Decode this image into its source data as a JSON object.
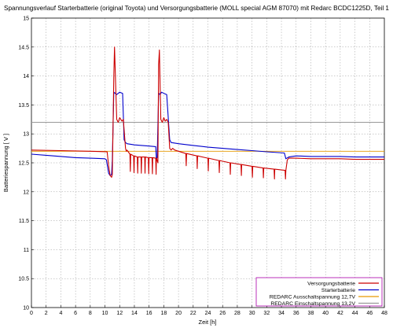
{
  "chart_data": {
    "type": "line",
    "title": "Spannungsverlauf Starterbatterie (original Toyota) und Versorgungsbatterie (MOLL special AGM 87070) mit Redarc BCDC1225D, Teil 1",
    "xlabel": "Zeit [h]",
    "ylabel": "Batteriespannung [ V ]",
    "xlim": [
      0,
      48
    ],
    "ylim": [
      10,
      15
    ],
    "x_ticks": [
      "0",
      "2",
      "4",
      "6",
      "8",
      "10",
      "12",
      "14",
      "16",
      "18",
      "20",
      "22",
      "24",
      "26",
      "28",
      "30",
      "32",
      "34",
      "36",
      "38",
      "40",
      "42",
      "44",
      "46",
      "48"
    ],
    "y_ticks": [
      "10",
      "10.5",
      "11",
      "11.5",
      "12",
      "12.5",
      "13",
      "13.5",
      "14",
      "14.5",
      "15"
    ],
    "grid": true,
    "legend_position": "bottom-right",
    "series": [
      {
        "name": "Versorgungsbatterie",
        "color": "#cc0000",
        "x": [
          0,
          4,
          8,
          10.3,
          10.5,
          10.7,
          10.9,
          11.0,
          11.2,
          11.3,
          11.6,
          11.8,
          12.0,
          12.3,
          12.5,
          12.8,
          12.9,
          13.0,
          13.4,
          13.45,
          13.5,
          13.9,
          13.95,
          14.0,
          14.4,
          14.45,
          14.5,
          14.9,
          14.95,
          15.0,
          15.4,
          15.45,
          15.5,
          15.9,
          15.95,
          16.0,
          16.4,
          16.45,
          16.5,
          16.9,
          16.95,
          17.0,
          17.2,
          17.3,
          17.4,
          17.6,
          17.8,
          18.0,
          18.2,
          18.4,
          18.6,
          18.8,
          19.0,
          19.2,
          19.5,
          20.0,
          21.0,
          21.05,
          21.1,
          22.5,
          22.55,
          22.6,
          24.0,
          24.05,
          24.1,
          25.5,
          25.55,
          25.6,
          27.0,
          27.05,
          27.1,
          28.5,
          28.55,
          28.6,
          30.0,
          30.05,
          30.1,
          31.5,
          31.55,
          31.6,
          33.0,
          33.05,
          33.1,
          34.5,
          34.55,
          34.6,
          34.8,
          35.0,
          36,
          38,
          40,
          42,
          44,
          46,
          48
        ],
        "y": [
          12.72,
          12.71,
          12.7,
          12.69,
          12.45,
          12.28,
          12.25,
          12.3,
          14.0,
          14.5,
          13.25,
          13.2,
          13.28,
          13.22,
          13.25,
          12.75,
          12.7,
          12.72,
          12.65,
          12.35,
          12.65,
          12.62,
          12.33,
          12.62,
          12.6,
          12.32,
          12.6,
          12.6,
          12.32,
          12.6,
          12.6,
          12.32,
          12.6,
          12.59,
          12.31,
          12.59,
          12.59,
          12.31,
          12.59,
          12.58,
          12.3,
          12.58,
          12.5,
          14.2,
          14.45,
          13.25,
          13.2,
          13.28,
          13.22,
          13.25,
          13.2,
          12.75,
          12.72,
          12.75,
          12.72,
          12.7,
          12.66,
          12.45,
          12.66,
          12.62,
          12.4,
          12.62,
          12.58,
          12.36,
          12.58,
          12.54,
          12.33,
          12.54,
          12.5,
          12.3,
          12.5,
          12.47,
          12.28,
          12.47,
          12.44,
          12.25,
          12.44,
          12.41,
          12.24,
          12.41,
          12.39,
          12.22,
          12.39,
          12.37,
          12.22,
          12.37,
          12.55,
          12.58,
          12.58,
          12.57,
          12.57,
          12.57,
          12.56,
          12.56,
          12.56
        ]
      },
      {
        "name": "Starterbatterie",
        "color": "#0000cc",
        "x": [
          0,
          2,
          4,
          6,
          8,
          10.0,
          10.2,
          10.5,
          10.7,
          10.9,
          11.0,
          11.2,
          11.4,
          11.6,
          12.0,
          12.4,
          12.6,
          12.8,
          13.0,
          14.0,
          15.0,
          16.0,
          16.9,
          17.0,
          17.1,
          17.3,
          17.5,
          17.7,
          18.0,
          18.4,
          18.8,
          19.0,
          20,
          22,
          24,
          26,
          28,
          30,
          32,
          34.4,
          34.6,
          35.0,
          36,
          38,
          40,
          42,
          44,
          46,
          48
        ],
        "y": [
          12.65,
          12.63,
          12.61,
          12.59,
          12.58,
          12.57,
          12.55,
          12.32,
          12.28,
          12.3,
          12.55,
          13.72,
          13.7,
          13.68,
          13.72,
          13.7,
          12.9,
          12.85,
          12.83,
          12.81,
          12.8,
          12.79,
          12.78,
          12.55,
          12.6,
          13.7,
          13.68,
          13.72,
          13.7,
          13.68,
          12.9,
          12.85,
          12.83,
          12.8,
          12.77,
          12.75,
          12.73,
          12.71,
          12.69,
          12.67,
          12.57,
          12.6,
          12.62,
          12.61,
          12.61,
          12.61,
          12.6,
          12.6,
          12.6
        ]
      },
      {
        "name": "REDARC Ausschaltspannung 12,7V",
        "color": "#e69900",
        "x": [
          0,
          48
        ],
        "y": [
          12.7,
          12.7
        ]
      },
      {
        "name": "REDARC Einschaltspannung 13,2V",
        "color": "#999999",
        "x": [
          0,
          48
        ],
        "y": [
          13.2,
          13.2
        ]
      }
    ]
  }
}
